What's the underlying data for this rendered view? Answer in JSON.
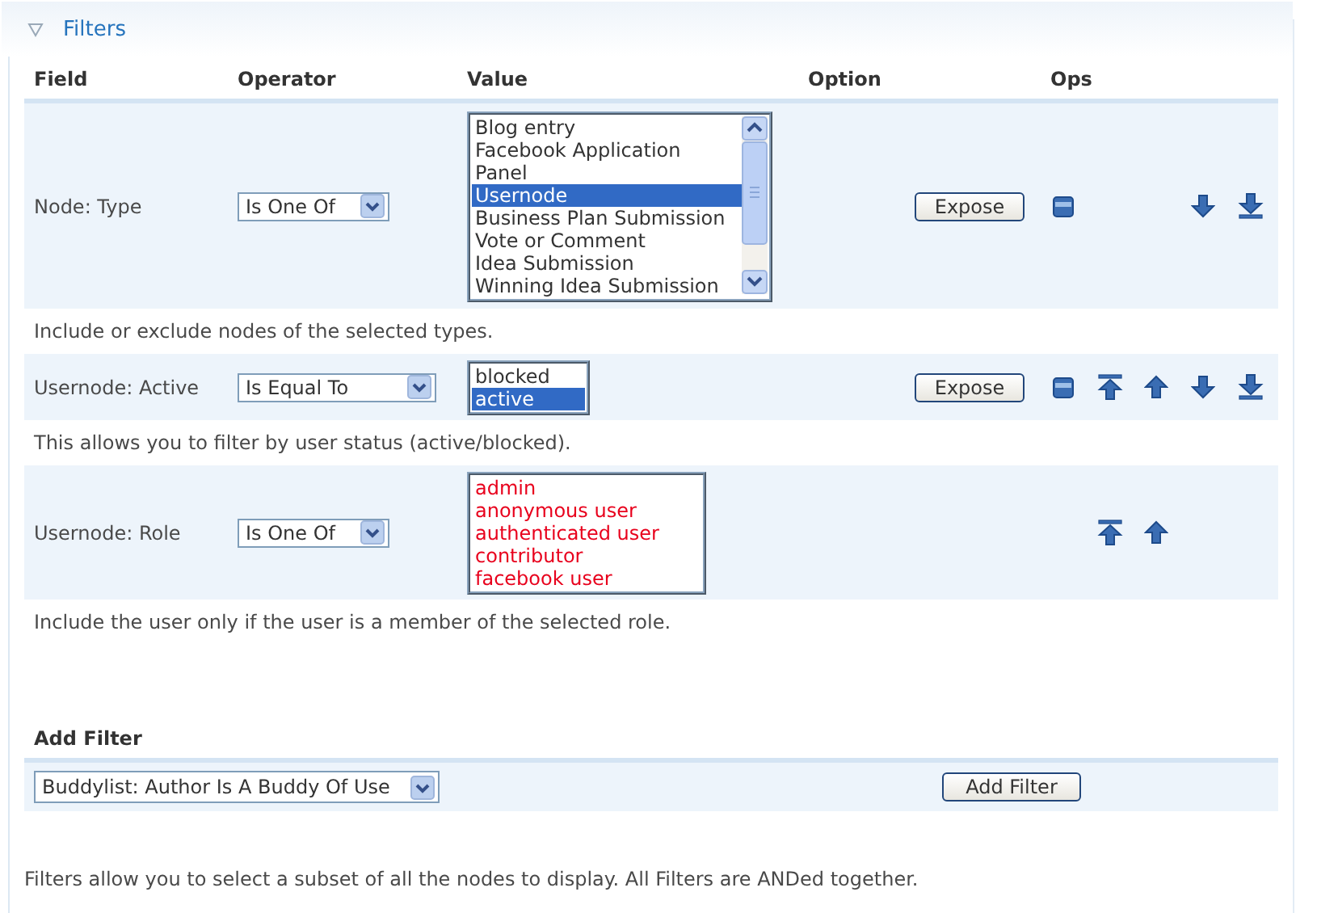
{
  "legend": {
    "title": "Filters",
    "expanded": true
  },
  "columns": [
    "Field",
    "Operator",
    "Value",
    "Option",
    "Ops"
  ],
  "filters": [
    {
      "field": "Node: Type",
      "operator": "Is One Of",
      "scrollable": true,
      "error": false,
      "values": [
        {
          "label": "Blog entry",
          "selected": false
        },
        {
          "label": "Facebook Application",
          "selected": false
        },
        {
          "label": "Panel",
          "selected": false
        },
        {
          "label": "Usernode",
          "selected": true
        },
        {
          "label": "Business Plan Submission",
          "selected": false
        },
        {
          "label": "Vote or Comment",
          "selected": false
        },
        {
          "label": "Idea Submission",
          "selected": false
        },
        {
          "label": "Winning Idea Submission",
          "selected": false
        }
      ],
      "option": "Expose",
      "ops": [
        {
          "kind": "remove"
        },
        {
          "kind": "down"
        },
        {
          "kind": "bottom"
        }
      ],
      "description": "Include or exclude nodes of the selected types."
    },
    {
      "field": "Usernode: Active",
      "operator": "Is Equal To",
      "scrollable": false,
      "error": false,
      "values": [
        {
          "label": "blocked",
          "selected": false
        },
        {
          "label": "active",
          "selected": true
        }
      ],
      "option": "Expose",
      "ops": [
        {
          "kind": "remove"
        },
        {
          "kind": "top"
        },
        {
          "kind": "up"
        },
        {
          "kind": "down"
        },
        {
          "kind": "bottom"
        }
      ],
      "description": "This allows you to filter by user status (active/blocked)."
    },
    {
      "field": "Usernode: Role",
      "operator": "Is One Of",
      "scrollable": false,
      "error": true,
      "values": [
        {
          "label": "admin",
          "selected": false
        },
        {
          "label": "anonymous user",
          "selected": false
        },
        {
          "label": "authenticated user",
          "selected": false
        },
        {
          "label": "contributor",
          "selected": false
        },
        {
          "label": "facebook user",
          "selected": false
        }
      ],
      "ops": [
        {
          "kind": "top"
        },
        {
          "kind": "up"
        }
      ],
      "description": "Include the user only if the user is a member of the selected role."
    }
  ],
  "add_filter": {
    "heading": "Add Filter",
    "selection": "Buddylist: Author Is A Buddy Of Use",
    "button": "Add Filter"
  },
  "footer": "Filters allow you to select a subset of all the nodes to display. All Filters are ANDed together."
}
